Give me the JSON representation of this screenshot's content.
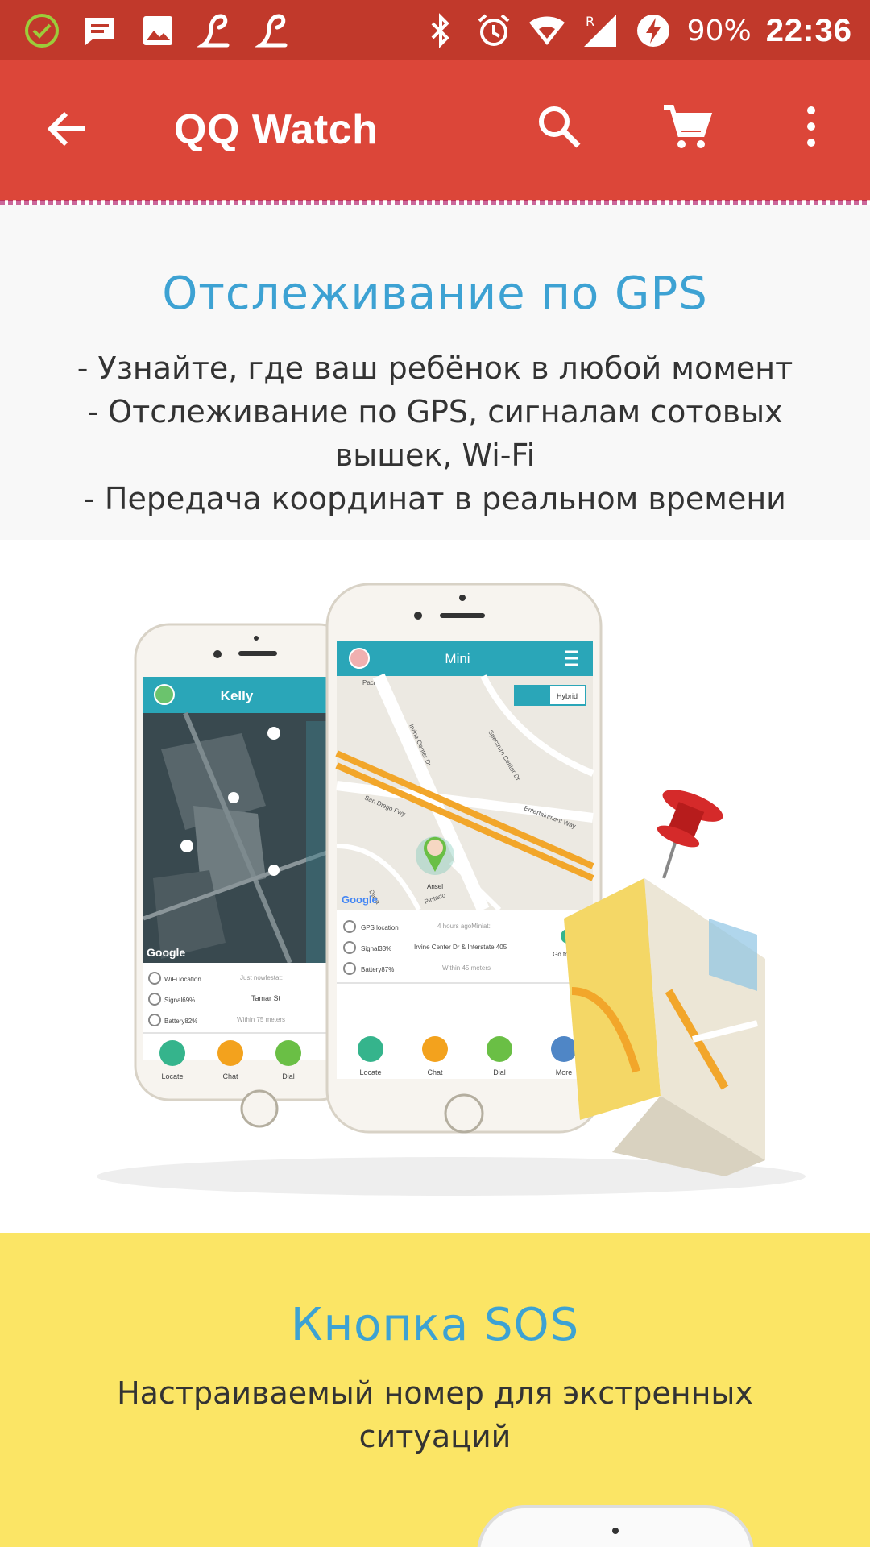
{
  "status_bar": {
    "battery_percent": "90%",
    "time": "22:36",
    "network_roaming": "R",
    "icons": [
      "check-circle-icon",
      "message-icon",
      "image-icon",
      "lp-icon",
      "lp-icon",
      "bluetooth-icon",
      "alarm-icon",
      "wifi-icon",
      "signal-icon",
      "battery-charging-icon"
    ]
  },
  "app_bar": {
    "title": "QQ Watch",
    "icons": [
      "back-arrow-icon",
      "search-icon",
      "cart-icon",
      "more-vert-icon"
    ]
  },
  "gps_section": {
    "heading": "Отслеживание по GPS",
    "lines": [
      "- Узнайте, где ваш ребёнок в любой момент",
      "- Отслеживание по GPS, сигналам сотовых вышек, Wi-Fi",
      "- Передача координат в реальном времени"
    ]
  },
  "illustration": {
    "left_phone": {
      "header": "Kelly",
      "map_label": "Google",
      "rows": [
        {
          "label": "WiFi location",
          "value": "Just nowlestat:"
        },
        {
          "label": "Signal69%",
          "value": "Tamar St"
        },
        {
          "label": "Battery82%",
          "value": "Within 75 meters"
        }
      ],
      "actions": [
        "Locate",
        "Chat",
        "Dial"
      ]
    },
    "right_phone": {
      "header": "Mini",
      "map_toggle": "Hybrid",
      "map_place": "Pacifica",
      "map_streets": [
        "Irvine Center Dr",
        "San Diego Fwy",
        "Spectrum Center Dr",
        "Entertainment Way",
        "Dana",
        "Pintado"
      ],
      "marker_name": "Ansel",
      "map_label": "Google",
      "rows": [
        {
          "label": "GPS location",
          "value": "4 hours agoMiniat:"
        },
        {
          "label": "Signal33%",
          "value": "Irvine Center Dr & Interstate 405"
        },
        {
          "label": "Battery87%",
          "value": "Within 45 meters"
        }
      ],
      "go_here": "Go to here",
      "actions": [
        "Locate",
        "Chat",
        "Dial",
        "More"
      ]
    },
    "colors": {
      "teal": "#2aa6b8",
      "road_orange": "#f2a62a",
      "locate_green": "#35b48c",
      "chat_orange": "#f3a21d",
      "dial_green": "#6abf45",
      "more_blue": "#4f86c6",
      "pin_red": "#d52a2a"
    }
  },
  "sos_section": {
    "heading": "Кнопка SOS",
    "lines": [
      "Настраиваемый номер для экстренных ситуаций"
    ]
  },
  "colors": {
    "status_bar": "#c1392b",
    "app_bar": "#dc4639",
    "heading_blue": "#3da2d3",
    "sos_background": "#fbe565"
  }
}
